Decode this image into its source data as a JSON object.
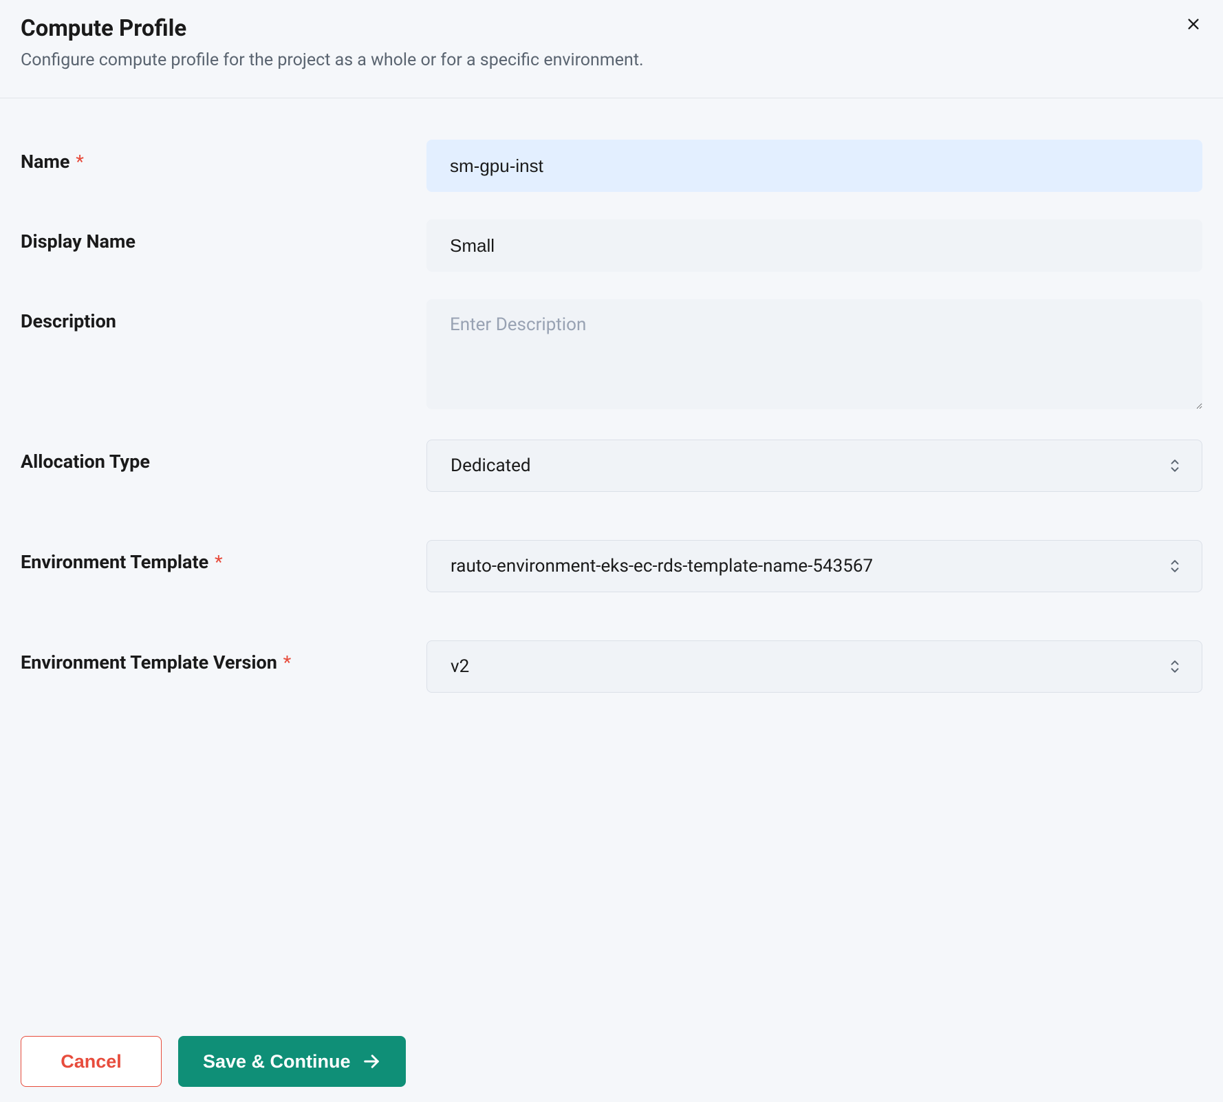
{
  "header": {
    "title": "Compute Profile",
    "subtitle": "Configure compute profile for the project as a whole or for a specific environment."
  },
  "form": {
    "name": {
      "label": "Name",
      "value": "sm-gpu-inst",
      "required": true
    },
    "displayName": {
      "label": "Display Name",
      "value": "Small",
      "required": false
    },
    "description": {
      "label": "Description",
      "value": "",
      "placeholder": "Enter Description",
      "required": false
    },
    "allocationType": {
      "label": "Allocation Type",
      "value": "Dedicated",
      "required": false
    },
    "environmentTemplate": {
      "label": "Environment Template",
      "value": "rauto-environment-eks-ec-rds-template-name-543567",
      "required": true
    },
    "environmentTemplateVersion": {
      "label": "Environment Template Version",
      "value": "v2",
      "required": true
    }
  },
  "footer": {
    "cancel": "Cancel",
    "saveContinue": "Save & Continue"
  }
}
